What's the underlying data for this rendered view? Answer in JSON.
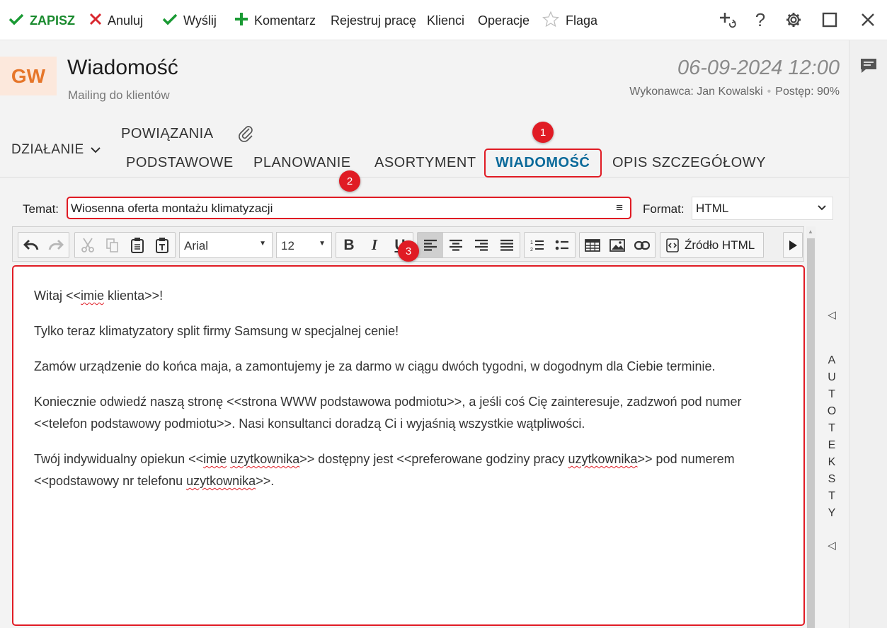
{
  "toolbar": {
    "save": "ZAPISZ",
    "cancel": "Anuluj",
    "send": "Wyślij",
    "comment": "Komentarz",
    "log_work": "Rejestruj pracę",
    "clients": "Klienci",
    "operations": "Operacje",
    "flag": "Flaga"
  },
  "header": {
    "avatar": "GW",
    "title": "Wiadomość",
    "subtitle": "Mailing do klientów",
    "date": "06-09-2024 12:00",
    "executor": "Wykonawca: Jan Kowalski",
    "separator": "•",
    "progress": "Postęp: 90%"
  },
  "tabs": {
    "action": "DZIAŁANIE",
    "links": "POWIĄZANIA",
    "items": [
      "PODSTAWOWE",
      "PLANOWANIE",
      "ASORTYMENT",
      "WIADOMOŚĆ",
      "OPIS SZCZEGÓŁOWY"
    ],
    "active": "WIADOMOŚĆ"
  },
  "badges": [
    "1",
    "2",
    "3"
  ],
  "form": {
    "subject_label": "Temat:",
    "subject_value": "Wiosenna oferta montażu klimatyzacji",
    "format_label": "Format:",
    "format_value": "HTML"
  },
  "editor": {
    "font": "Arial",
    "size": "12",
    "source_label": "Źródło HTML",
    "paragraphs": [
      "Witaj <<imie klienta>>!",
      "Tylko teraz klimatyzatory split firmy Samsung w specjalnej cenie!",
      "Zamów urządzenie do końca maja, a zamontujemy je za darmo w ciągu dwóch tygodni, w dogodnym dla Ciebie terminie.",
      "Koniecznie odwiedź naszą stronę <<strona WWW podstawowa podmiotu>>, a jeśli coś Cię zainteresuje, zadzwoń pod numer <<telefon podstawowy podmiotu>>. Nasi konsultanci doradzą Ci i wyjaśnią wszystkie wątpliwości.",
      "Twój indywidualny opiekun <<imie uzytkownika>> dostępny jest <<preferowane godziny pracy uzytkownika>> pod numerem <<podstawowy nr telefonu uzytkownika>>."
    ]
  },
  "autotexts": {
    "label": "AUTOTEKSTY",
    "letters": [
      "A",
      "U",
      "T",
      "O",
      "T",
      "E",
      "K",
      "S",
      "T",
      "Y"
    ]
  },
  "colors": {
    "accent": "#0b6a9a",
    "highlight": "#e01b24",
    "save_green": "#1a8a2e",
    "avatar_bg": "#fce8dc",
    "avatar_text": "#e6762a"
  },
  "icons": [
    "check-icon",
    "close-icon",
    "plus-icon",
    "star-icon",
    "add-link-icon",
    "help-icon",
    "gear-icon",
    "maximize-icon",
    "close-window-icon",
    "chat-icon",
    "paperclip-icon",
    "chevron-down-icon",
    "menu-icon"
  ]
}
